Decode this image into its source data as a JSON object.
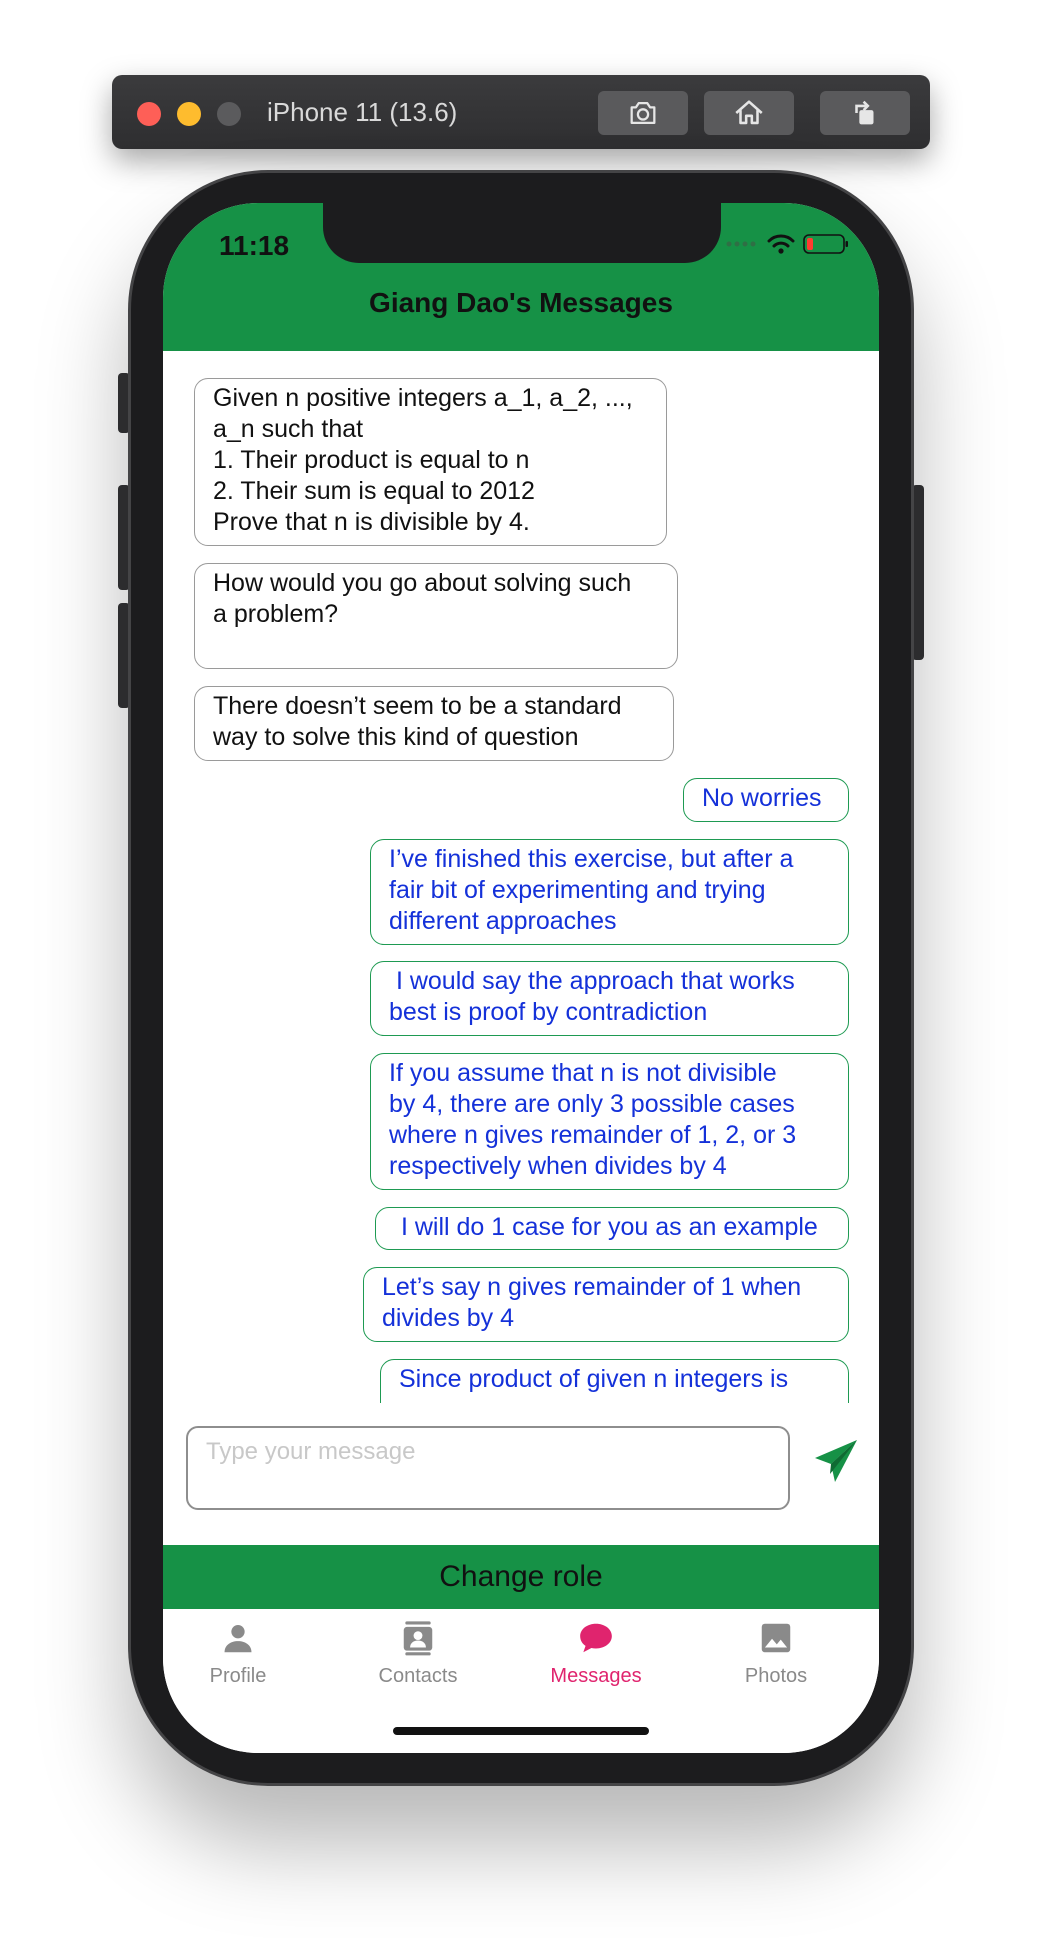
{
  "simulator": {
    "title": "iPhone 11 (13.6)",
    "buttons": [
      "camera-icon",
      "home-icon",
      "rotate-icon"
    ]
  },
  "status_bar": {
    "time": "11:18",
    "battery_level": 0.15
  },
  "header": {
    "title": "Giang Dao's Messages"
  },
  "messages": [
    {
      "side": "incoming",
      "text": "Given n positive integers a_1, a_2, ...,\na_n such that\n1. Their product is equal to n\n2. Their sum is equal to 2012\nProve that n is divisible by 4."
    },
    {
      "side": "incoming",
      "text": "How would you go about solving such\na problem?\n"
    },
    {
      "side": "incoming",
      "text": "There doesn’t seem to be a standard\nway to solve this kind of question"
    },
    {
      "side": "outgoing",
      "text": "No worries"
    },
    {
      "side": "outgoing",
      "text": "I’ve finished this exercise, but after a\nfair bit of experimenting and trying\ndifferent approaches"
    },
    {
      "side": "outgoing",
      "text": " I would say the approach that works\nbest is proof by contradiction"
    },
    {
      "side": "outgoing",
      "text": "If you assume that n is not divisible\nby 4, there are only 3 possible cases\nwhere n gives remainder of 1, 2, or 3\nrespectively when divides by 4"
    },
    {
      "side": "outgoing",
      "text": " I will do 1 case for you as an example"
    },
    {
      "side": "outgoing",
      "text": "Let’s say n gives remainder of 1 when\ndivides by 4"
    },
    {
      "side": "outgoing",
      "text": "Since product of given n integers is"
    }
  ],
  "composer": {
    "placeholder": "Type your message"
  },
  "change_role": {
    "label": "Change role"
  },
  "tabs": [
    {
      "label": "Profile",
      "icon": "person-icon",
      "active": false
    },
    {
      "label": "Contacts",
      "icon": "contacts-icon",
      "active": false
    },
    {
      "label": "Messages",
      "icon": "chat-bubble-icon",
      "active": true
    },
    {
      "label": "Photos",
      "icon": "photo-icon",
      "active": false
    }
  ],
  "colors": {
    "brand_green": "#169146",
    "outgoing_text": "#1431d9",
    "active_tab": "#e0246e"
  }
}
